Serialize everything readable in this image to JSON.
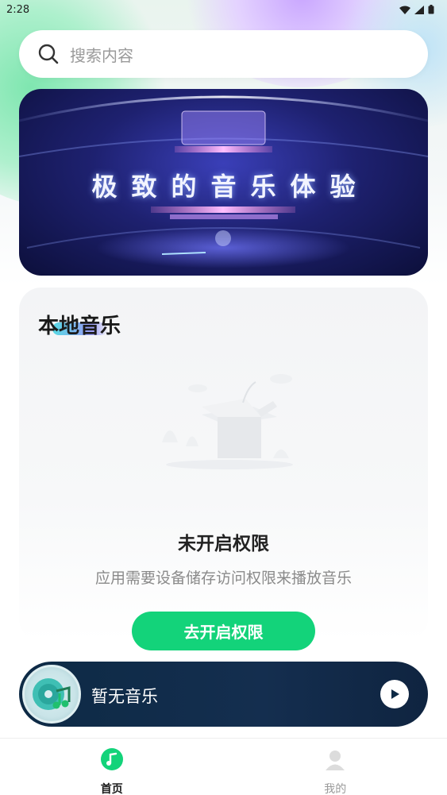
{
  "status_bar": {
    "time": "2:28",
    "icons": [
      "wifi-icon",
      "signal-icon",
      "battery-icon"
    ]
  },
  "search": {
    "placeholder": "搜索内容"
  },
  "banner": {
    "text": "极致的音乐体验"
  },
  "local_music": {
    "title": "本地音乐",
    "empty_title": "未开启权限",
    "empty_description": "应用需要设备储存访问权限来播放音乐",
    "grant_button_label": "去开启权限"
  },
  "player": {
    "title": "暂无音乐",
    "play_icon": "play-icon"
  },
  "bottom_nav": {
    "items": [
      {
        "label": "首页",
        "icon": "music-note-icon",
        "active": true
      },
      {
        "label": "我的",
        "icon": "user-icon",
        "active": false
      }
    ]
  },
  "colors": {
    "accent_green": "#13d37a",
    "player_bg": "#0d2a45",
    "banner_bg": "#1e2170"
  }
}
